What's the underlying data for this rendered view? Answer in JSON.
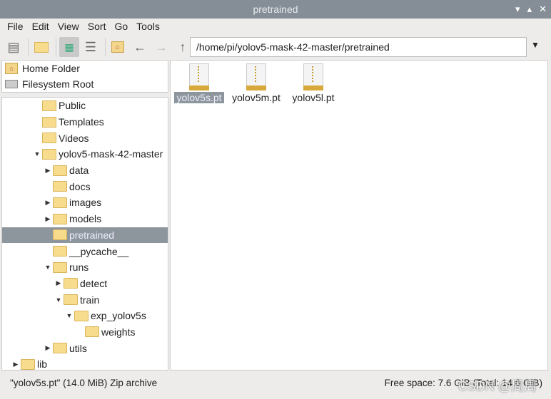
{
  "window": {
    "title": "pretrained"
  },
  "menu": [
    "File",
    "Edit",
    "View",
    "Sort",
    "Go",
    "Tools"
  ],
  "address": "/home/pi/yolov5-mask-42-master/pretrained",
  "places": [
    {
      "label": "Home Folder",
      "icon": "home-icon"
    },
    {
      "label": "Filesystem Root",
      "icon": "drive-icon"
    }
  ],
  "tree": [
    {
      "label": "Public",
      "level": 3,
      "expander": "none",
      "icon": "public-folder-icon"
    },
    {
      "label": "Templates",
      "level": 3,
      "expander": "none",
      "icon": "templates-folder-icon"
    },
    {
      "label": "Videos",
      "level": 3,
      "expander": "none",
      "icon": "videos-folder-icon"
    },
    {
      "label": "yolov5-mask-42-master",
      "level": 3,
      "expander": "open",
      "icon": "folder-icon"
    },
    {
      "label": "data",
      "level": 4,
      "expander": "closed",
      "icon": "folder-icon"
    },
    {
      "label": "docs",
      "level": 4,
      "expander": "none",
      "icon": "folder-icon"
    },
    {
      "label": "images",
      "level": 4,
      "expander": "closed",
      "icon": "folder-icon"
    },
    {
      "label": "models",
      "level": 4,
      "expander": "closed",
      "icon": "folder-icon"
    },
    {
      "label": "pretrained",
      "level": 4,
      "expander": "none",
      "icon": "folder-icon",
      "selected": true
    },
    {
      "label": "__pycache__",
      "level": 4,
      "expander": "none",
      "icon": "folder-icon"
    },
    {
      "label": "runs",
      "level": 4,
      "expander": "open",
      "icon": "folder-icon"
    },
    {
      "label": "detect",
      "level": 5,
      "expander": "closed",
      "icon": "folder-icon"
    },
    {
      "label": "train",
      "level": 5,
      "expander": "open",
      "icon": "folder-icon"
    },
    {
      "label": "exp_yolov5s",
      "level": 6,
      "expander": "open",
      "icon": "folder-icon"
    },
    {
      "label": "weights",
      "level": 7,
      "expander": "none",
      "icon": "folder-icon"
    },
    {
      "label": "utils",
      "level": 4,
      "expander": "closed",
      "icon": "folder-icon"
    },
    {
      "label": "lib",
      "level": 1,
      "expander": "closed",
      "icon": "folder-icon"
    }
  ],
  "files": [
    {
      "name": "yolov5s.pt",
      "selected": true
    },
    {
      "name": "yolov5m.pt"
    },
    {
      "name": "yolov5l.pt"
    }
  ],
  "status": {
    "selection": "\"yolov5s.pt\" (14.0 MiB) Zip archive",
    "free": "Free space: 7.6 GiB (Total: 14.6 GiB)"
  },
  "watermark": "CSDN @周周"
}
